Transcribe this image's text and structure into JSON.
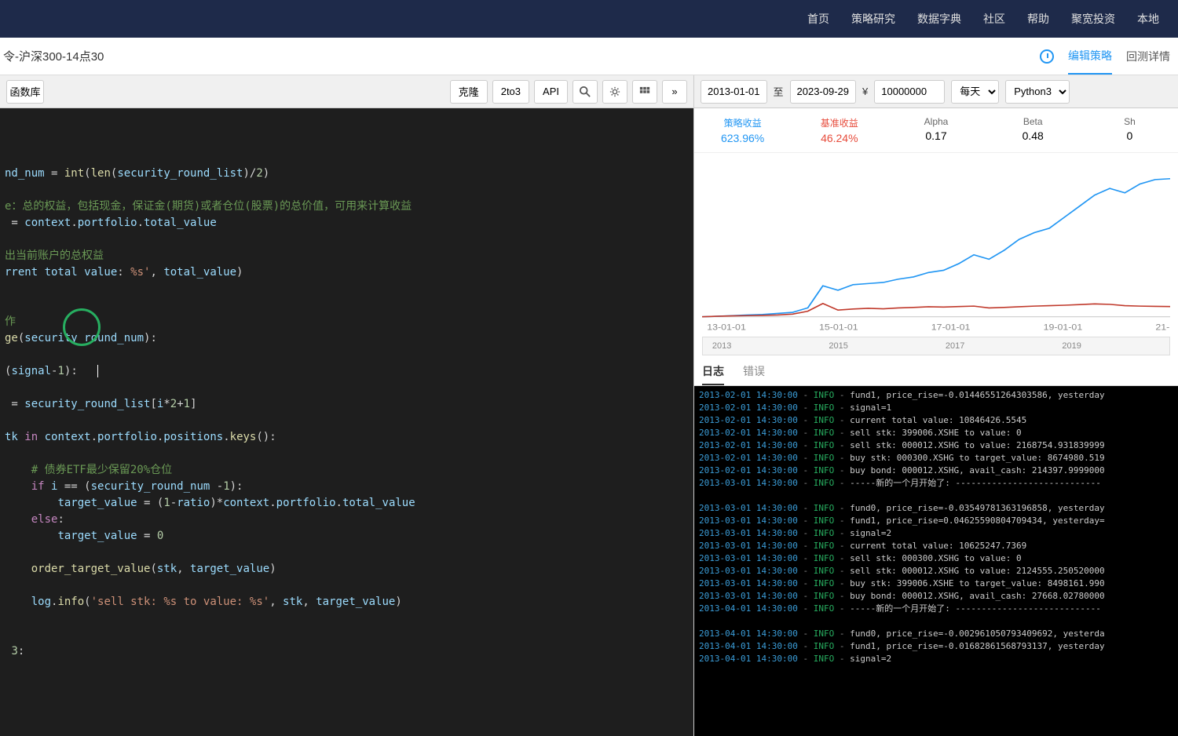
{
  "nav": {
    "items": [
      "首页",
      "策略研究",
      "数据字典",
      "社区",
      "帮助",
      "聚宽投资",
      "本地"
    ]
  },
  "subheader": {
    "title": "令-沪深300-14点30",
    "edit": "编辑策略",
    "detail": "回测详情"
  },
  "toolbar": {
    "lib": "函数库",
    "clone": "克隆",
    "to3": "2to3",
    "api": "API"
  },
  "backtest": {
    "start": "2013-01-01",
    "sep": "至",
    "end": "2023-09-29",
    "currency": "¥",
    "capital": "10000000",
    "freq": "每天",
    "lang": "Python3"
  },
  "metrics": [
    {
      "label": "策略收益",
      "value": "623.96%",
      "cls": "blue"
    },
    {
      "label": "基准收益",
      "value": "46.24%",
      "cls": "red"
    },
    {
      "label": "Alpha",
      "value": "0.17",
      "cls": ""
    },
    {
      "label": "Beta",
      "value": "0.48",
      "cls": ""
    },
    {
      "label": "Sh",
      "value": "0",
      "cls": ""
    }
  ],
  "chart_data": {
    "type": "line",
    "x_ticks": [
      "13-01-01",
      "15-01-01",
      "17-01-01",
      "19-01-01",
      "21-"
    ],
    "series": [
      {
        "name": "策略收益",
        "color": "#2196f3",
        "values": [
          0,
          2,
          5,
          8,
          10,
          15,
          20,
          40,
          140,
          120,
          145,
          150,
          155,
          170,
          180,
          200,
          210,
          240,
          280,
          260,
          300,
          350,
          380,
          400,
          450,
          500,
          550,
          580,
          560,
          600,
          620,
          624
        ]
      },
      {
        "name": "基准收益",
        "color": "#c0392b",
        "values": [
          0,
          2,
          4,
          5,
          6,
          8,
          12,
          25,
          60,
          30,
          35,
          38,
          36,
          40,
          42,
          45,
          44,
          46,
          48,
          40,
          42,
          45,
          48,
          50,
          52,
          55,
          58,
          56,
          50,
          48,
          47,
          46
        ]
      }
    ],
    "ylim": [
      0,
      700
    ]
  },
  "slider": {
    "ticks": [
      "2013",
      "2015",
      "2017",
      "2019"
    ]
  },
  "logtabs": {
    "log": "日志",
    "err": "错误"
  },
  "code": {
    "lines": [
      {
        "indent": 0,
        "parts": [
          [
            "var",
            "nd_num"
          ],
          [
            "op",
            " = "
          ],
          [
            "fn",
            "int"
          ],
          [
            "op",
            "("
          ],
          [
            "fn",
            "len"
          ],
          [
            "op",
            "("
          ],
          [
            "var",
            "security_round_list"
          ],
          [
            "op",
            ")/"
          ],
          [
            "num",
            "2"
          ],
          [
            "op",
            ")"
          ]
        ]
      },
      {
        "blank": true
      },
      {
        "indent": 0,
        "parts": [
          [
            "cmt",
            "e：总的权益，包括现金，保证金(期货)或者仓位(股票)的总价值，可用来计算收益"
          ]
        ]
      },
      {
        "indent": 0,
        "parts": [
          [
            "op",
            " = "
          ],
          [
            "var",
            "context"
          ],
          [
            "op",
            "."
          ],
          [
            "var",
            "portfolio"
          ],
          [
            "op",
            "."
          ],
          [
            "var",
            "total_value"
          ]
        ]
      },
      {
        "blank": true
      },
      {
        "indent": 0,
        "parts": [
          [
            "cmt",
            "出当前账户的总权益"
          ]
        ]
      },
      {
        "indent": 0,
        "parts": [
          [
            "var",
            "rrent total value"
          ],
          [
            "op",
            ": "
          ],
          [
            "str",
            "%s'"
          ],
          [
            "op",
            ", "
          ],
          [
            "var",
            "total_value"
          ],
          [
            "op",
            ")"
          ]
        ]
      },
      {
        "blank": true
      },
      {
        "blank": true
      },
      {
        "indent": 0,
        "parts": [
          [
            "cmt",
            "作"
          ]
        ]
      },
      {
        "indent": 0,
        "parts": [
          [
            "fn",
            "ge"
          ],
          [
            "op",
            "("
          ],
          [
            "var",
            "security_round_num"
          ],
          [
            "op",
            "):"
          ]
        ]
      },
      {
        "blank": true
      },
      {
        "indent": 0,
        "parts": [
          [
            "op",
            "("
          ],
          [
            "var",
            "signal"
          ],
          [
            "op",
            "-"
          ],
          [
            "num",
            "1"
          ],
          [
            "op",
            "):"
          ]
        ],
        "cursor": true
      },
      {
        "blank": true
      },
      {
        "indent": 0,
        "parts": [
          [
            "op",
            " = "
          ],
          [
            "var",
            "security_round_list"
          ],
          [
            "op",
            "["
          ],
          [
            "var",
            "i"
          ],
          [
            "op",
            "*"
          ],
          [
            "num",
            "2"
          ],
          [
            "op",
            "+"
          ],
          [
            "num",
            "1"
          ],
          [
            "op",
            "]"
          ]
        ]
      },
      {
        "blank": true
      },
      {
        "indent": 0,
        "parts": [
          [
            "var",
            "tk"
          ],
          [
            "op",
            " "
          ],
          [
            "kw",
            "in"
          ],
          [
            "op",
            " "
          ],
          [
            "var",
            "context"
          ],
          [
            "op",
            "."
          ],
          [
            "var",
            "portfolio"
          ],
          [
            "op",
            "."
          ],
          [
            "var",
            "positions"
          ],
          [
            "op",
            "."
          ],
          [
            "fn",
            "keys"
          ],
          [
            "op",
            "():"
          ]
        ]
      },
      {
        "blank": true
      },
      {
        "indent": 1,
        "parts": [
          [
            "cmt",
            "# 债券ETF最少保留20%仓位"
          ]
        ]
      },
      {
        "indent": 1,
        "parts": [
          [
            "kw",
            "if"
          ],
          [
            "op",
            " "
          ],
          [
            "var",
            "i"
          ],
          [
            "op",
            " == ("
          ],
          [
            "var",
            "security_round_num"
          ],
          [
            "op",
            " -"
          ],
          [
            "num",
            "1"
          ],
          [
            "op",
            "):"
          ]
        ]
      },
      {
        "indent": 2,
        "parts": [
          [
            "var",
            "target_value"
          ],
          [
            "op",
            " = ("
          ],
          [
            "num",
            "1"
          ],
          [
            "op",
            "-"
          ],
          [
            "var",
            "ratio"
          ],
          [
            "op",
            ")*"
          ],
          [
            "var",
            "context"
          ],
          [
            "op",
            "."
          ],
          [
            "var",
            "portfolio"
          ],
          [
            "op",
            "."
          ],
          [
            "var",
            "total_value"
          ]
        ]
      },
      {
        "indent": 1,
        "parts": [
          [
            "kw",
            "else"
          ],
          [
            "op",
            ":"
          ]
        ]
      },
      {
        "indent": 2,
        "parts": [
          [
            "var",
            "target_value"
          ],
          [
            "op",
            " = "
          ],
          [
            "num",
            "0"
          ]
        ]
      },
      {
        "blank": true
      },
      {
        "indent": 1,
        "parts": [
          [
            "fn",
            "order_target_value"
          ],
          [
            "op",
            "("
          ],
          [
            "var",
            "stk"
          ],
          [
            "op",
            ", "
          ],
          [
            "var",
            "target_value"
          ],
          [
            "op",
            ")"
          ]
        ]
      },
      {
        "blank": true
      },
      {
        "indent": 1,
        "parts": [
          [
            "var",
            "log"
          ],
          [
            "op",
            "."
          ],
          [
            "fn",
            "info"
          ],
          [
            "op",
            "("
          ],
          [
            "str",
            "'sell stk: %s to value: %s'"
          ],
          [
            "op",
            ", "
          ],
          [
            "var",
            "stk"
          ],
          [
            "op",
            ", "
          ],
          [
            "var",
            "target_value"
          ],
          [
            "op",
            ")"
          ]
        ]
      },
      {
        "blank": true
      },
      {
        "blank": true
      },
      {
        "indent": 0,
        "parts": [
          [
            "op",
            " "
          ],
          [
            "num",
            "3"
          ],
          [
            "op",
            ":"
          ]
        ]
      }
    ]
  },
  "logs": [
    {
      "t": "2013-02-01 14:30:00",
      "l": "INFO",
      "m": "fund1, price_rise=-0.01446551264303586, yesterday"
    },
    {
      "t": "2013-02-01 14:30:00",
      "l": "INFO",
      "m": "signal=1"
    },
    {
      "t": "2013-02-01 14:30:00",
      "l": "INFO",
      "m": "current total value: 10846426.5545"
    },
    {
      "t": "2013-02-01 14:30:00",
      "l": "INFO",
      "m": "sell stk: 399006.XSHE to value: 0"
    },
    {
      "t": "2013-02-01 14:30:00",
      "l": "INFO",
      "m": "sell stk: 000012.XSHG to value: 2168754.931839999"
    },
    {
      "t": "2013-02-01 14:30:00",
      "l": "INFO",
      "m": "buy stk: 000300.XSHG to target_value: 8674980.519"
    },
    {
      "t": "2013-02-01 14:30:00",
      "l": "INFO",
      "m": "buy bond: 000012.XSHG, avail_cash: 214397.9999000"
    },
    {
      "t": "2013-03-01 14:30:00",
      "l": "INFO",
      "m": "-----新的一个月开始了: ----------------------------"
    },
    {
      "blank": true
    },
    {
      "t": "2013-03-01 14:30:00",
      "l": "INFO",
      "m": "fund0, price_rise=-0.03549781363196858, yesterday"
    },
    {
      "t": "2013-03-01 14:30:00",
      "l": "INFO",
      "m": "fund1, price_rise=0.04625590804709434, yesterday="
    },
    {
      "t": "2013-03-01 14:30:00",
      "l": "INFO",
      "m": "signal=2"
    },
    {
      "t": "2013-03-01 14:30:00",
      "l": "INFO",
      "m": "current total value: 10625247.7369"
    },
    {
      "t": "2013-03-01 14:30:00",
      "l": "INFO",
      "m": "sell stk: 000300.XSHG to value: 0"
    },
    {
      "t": "2013-03-01 14:30:00",
      "l": "INFO",
      "m": "sell stk: 000012.XSHG to value: 2124555.250520000"
    },
    {
      "t": "2013-03-01 14:30:00",
      "l": "INFO",
      "m": "buy stk: 399006.XSHE to target_value: 8498161.990"
    },
    {
      "t": "2013-03-01 14:30:00",
      "l": "INFO",
      "m": "buy bond: 000012.XSHG, avail_cash: 27668.02780000"
    },
    {
      "t": "2013-04-01 14:30:00",
      "l": "INFO",
      "m": "-----新的一个月开始了: ----------------------------"
    },
    {
      "blank": true
    },
    {
      "t": "2013-04-01 14:30:00",
      "l": "INFO",
      "m": "fund0, price_rise=-0.002961050793409692, yesterda"
    },
    {
      "t": "2013-04-01 14:30:00",
      "l": "INFO",
      "m": "fund1, price_rise=-0.01682861568793137, yesterday"
    },
    {
      "t": "2013-04-01 14:30:00",
      "l": "INFO",
      "m": "signal=2"
    }
  ]
}
